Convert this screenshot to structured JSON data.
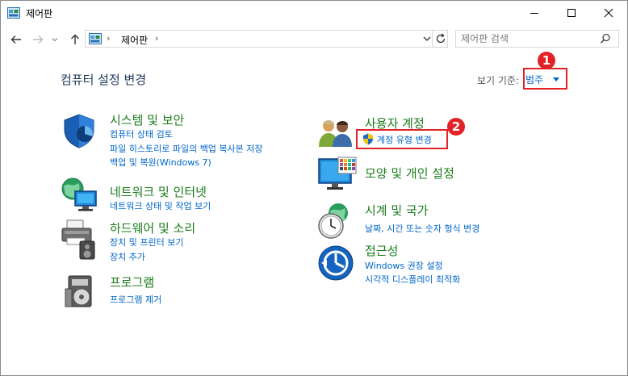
{
  "window": {
    "title": "제어판"
  },
  "address": {
    "path": "제어판"
  },
  "search": {
    "placeholder": "제어판 검색"
  },
  "header": {
    "title": "컴퓨터 설정 변경",
    "view_by_label": "보기 기준:",
    "view_by_value": "범주"
  },
  "badges": {
    "one": "1",
    "two": "2"
  },
  "categories": {
    "system": {
      "title": "시스템 및 보안",
      "links": [
        "컴퓨터 상태 검토",
        "파일 히스토리로 파일의 백업 복사본 저장",
        "백업 및 복원(Windows 7)"
      ]
    },
    "network": {
      "title": "네트워크 및 인터넷",
      "links": [
        "네트워크 상태 및 작업 보기"
      ]
    },
    "hardware": {
      "title": "하드웨어 및 소리",
      "links": [
        "장치 및 프린터 보기",
        "장치 추가"
      ]
    },
    "programs": {
      "title": "프로그램",
      "links": [
        "프로그램 제거"
      ]
    },
    "accounts": {
      "title": "사용자 계정",
      "links": [
        "계정 유형 변경"
      ]
    },
    "appearance": {
      "title": "모양 및 개인 설정",
      "links": []
    },
    "clock": {
      "title": "시계 및 국가",
      "links": [
        "날짜, 시간 또는 숫자 형식 변경"
      ]
    },
    "access": {
      "title": "접근성",
      "links": [
        "Windows 권장 설정",
        "시각적 디스플레이 최적화"
      ]
    }
  },
  "colors": {
    "title_green": "#1a7c1a",
    "link_blue": "#0066cc",
    "highlight_red": "#e32226"
  },
  "icons": [
    "control-panel-icon",
    "back-arrow-icon",
    "forward-arrow-icon",
    "up-arrow-icon",
    "refresh-icon",
    "search-icon",
    "shield-icon",
    "globe-network-icon",
    "printer-icon",
    "programs-icon",
    "users-icon",
    "uac-shield-icon",
    "monitor-palette-icon",
    "clock-globe-icon",
    "accessibility-icon"
  ]
}
